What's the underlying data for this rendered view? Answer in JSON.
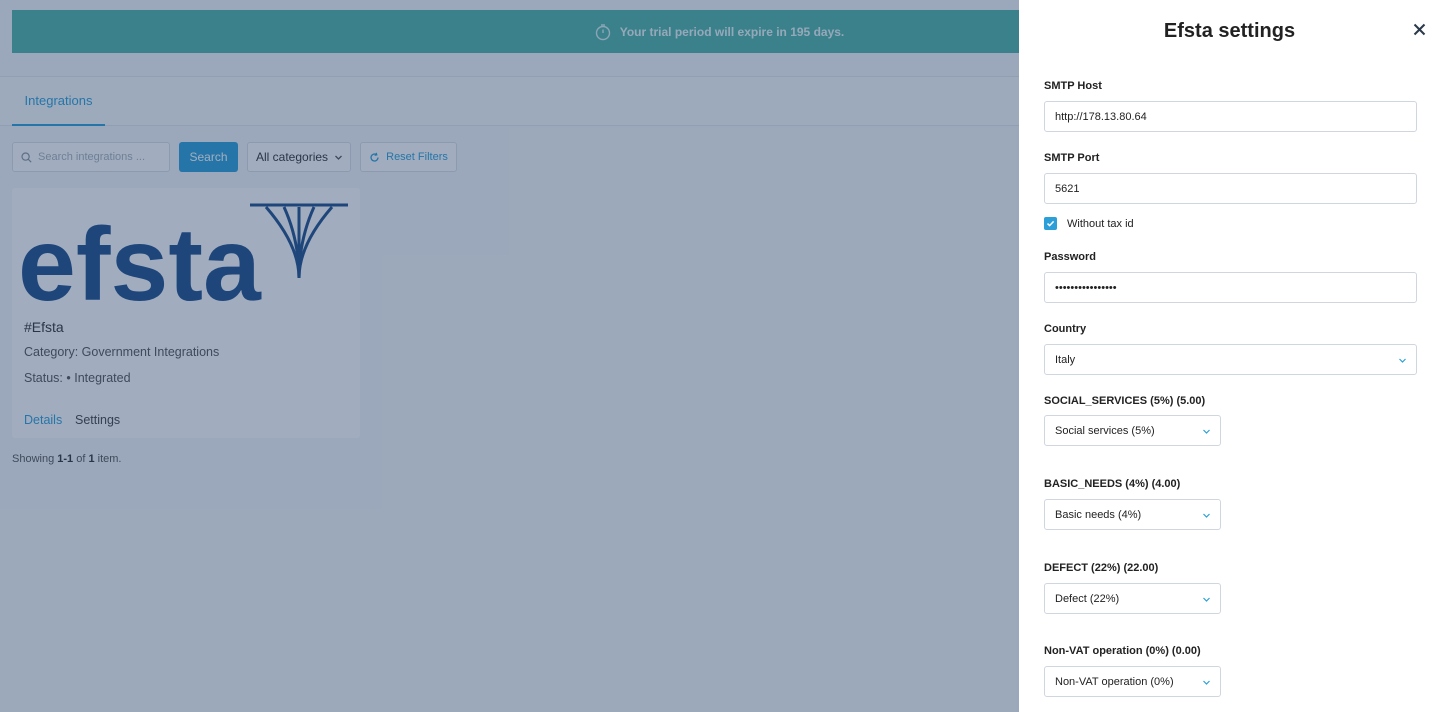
{
  "banner": {
    "text": "Your trial period will expire in 195 days."
  },
  "tabs": {
    "integrations": "Integrations"
  },
  "filters": {
    "search_placeholder": "Search integrations ...",
    "search_button": "Search",
    "category_selected": "All categories",
    "reset_label": "Reset Filters"
  },
  "card": {
    "name": "#Efsta",
    "category": "Category: Government Integrations",
    "status": "Status: • Integrated",
    "details_link": "Details",
    "settings_link": "Settings",
    "logo_text": "efsta"
  },
  "pagination": {
    "prefix": "Showing ",
    "range": "1-1",
    "middle": " of ",
    "total": "1",
    "suffix": " item."
  },
  "panel": {
    "title": "Efsta settings",
    "smtp_host": {
      "label": "SMTP Host",
      "value": "http://178.13.80.64"
    },
    "smtp_port": {
      "label": "SMTP Port",
      "value": "5621"
    },
    "without_tax_id": {
      "label": "Without tax id",
      "checked": true
    },
    "password": {
      "label": "Password",
      "value": "................"
    },
    "country": {
      "label": "Country",
      "value": "Italy"
    },
    "social_services": {
      "label": "SOCIAL_SERVICES (5%) (5.00)",
      "value": "Social services (5%)"
    },
    "basic_needs": {
      "label": "BASIC_NEEDS (4%) (4.00)",
      "value": "Basic needs (4%)"
    },
    "defect": {
      "label": "DEFECT (22%) (22.00)",
      "value": "Defect (22%)"
    },
    "non_vat": {
      "label": "Non-VAT operation (0%) (0.00)",
      "value": "Non-VAT operation (0%)"
    }
  },
  "colors": {
    "accent": "#2c9fd9",
    "banner": "#4fb4a8",
    "overlay": "#1e3c64",
    "logo": "#1f4e8c"
  },
  "icons": {
    "banner": "stopwatch-icon",
    "search": "search-icon",
    "category": "chevron-down-icon",
    "reset": "refresh-icon",
    "close": "close-icon",
    "checkbox": "checkmark-icon",
    "select": "chevron-down-icon"
  }
}
